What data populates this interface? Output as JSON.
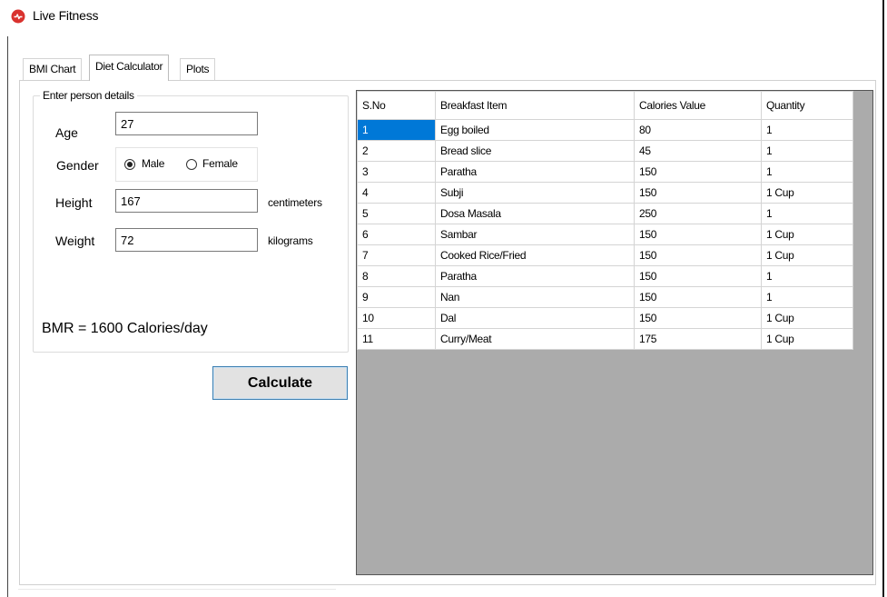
{
  "window": {
    "title": "Live Fitness"
  },
  "tabs": [
    {
      "label": "BMI Chart",
      "selected": false
    },
    {
      "label": "Diet Calculator",
      "selected": true
    },
    {
      "label": "Plots",
      "selected": false
    }
  ],
  "person": {
    "group_title": "Enter person details",
    "age_label": "Age",
    "age_value": "27",
    "gender_label": "Gender",
    "male_label": "Male",
    "female_label": "Female",
    "selected_gender": "Male",
    "height_label": "Height",
    "height_value": "167",
    "height_unit": "centimeters",
    "weight_label": "Weight",
    "weight_value": "72",
    "weight_unit": "kilograms",
    "bmr_text": "BMR = 1600 Calories/day"
  },
  "calculate_label": "Calculate",
  "grid": {
    "columns": [
      "S.No",
      "Breakfast Item",
      "Calories Value",
      "Quantity"
    ],
    "rows": [
      [
        "1",
        "Egg boiled",
        "80",
        "1"
      ],
      [
        "2",
        "Bread slice",
        "45",
        "1"
      ],
      [
        "3",
        "Paratha",
        "150",
        "1"
      ],
      [
        "4",
        "Subji",
        "150",
        "1 Cup"
      ],
      [
        "5",
        "Dosa Masala",
        "250",
        "1"
      ],
      [
        "6",
        "Sambar",
        "150",
        "1 Cup"
      ],
      [
        "7",
        "Cooked Rice/Fried",
        "150",
        "1 Cup"
      ],
      [
        "8",
        "Paratha",
        "150",
        "1"
      ],
      [
        "9",
        "Nan",
        "150",
        "1"
      ],
      [
        "10",
        "Dal",
        "150",
        "1 Cup"
      ],
      [
        "11",
        "Curry/Meat",
        "175",
        "1 Cup"
      ]
    ],
    "selected_row": 0
  },
  "colors": {
    "selection": "#0078d7",
    "grid_background": "#ababab",
    "app_icon": "#d9322e"
  }
}
